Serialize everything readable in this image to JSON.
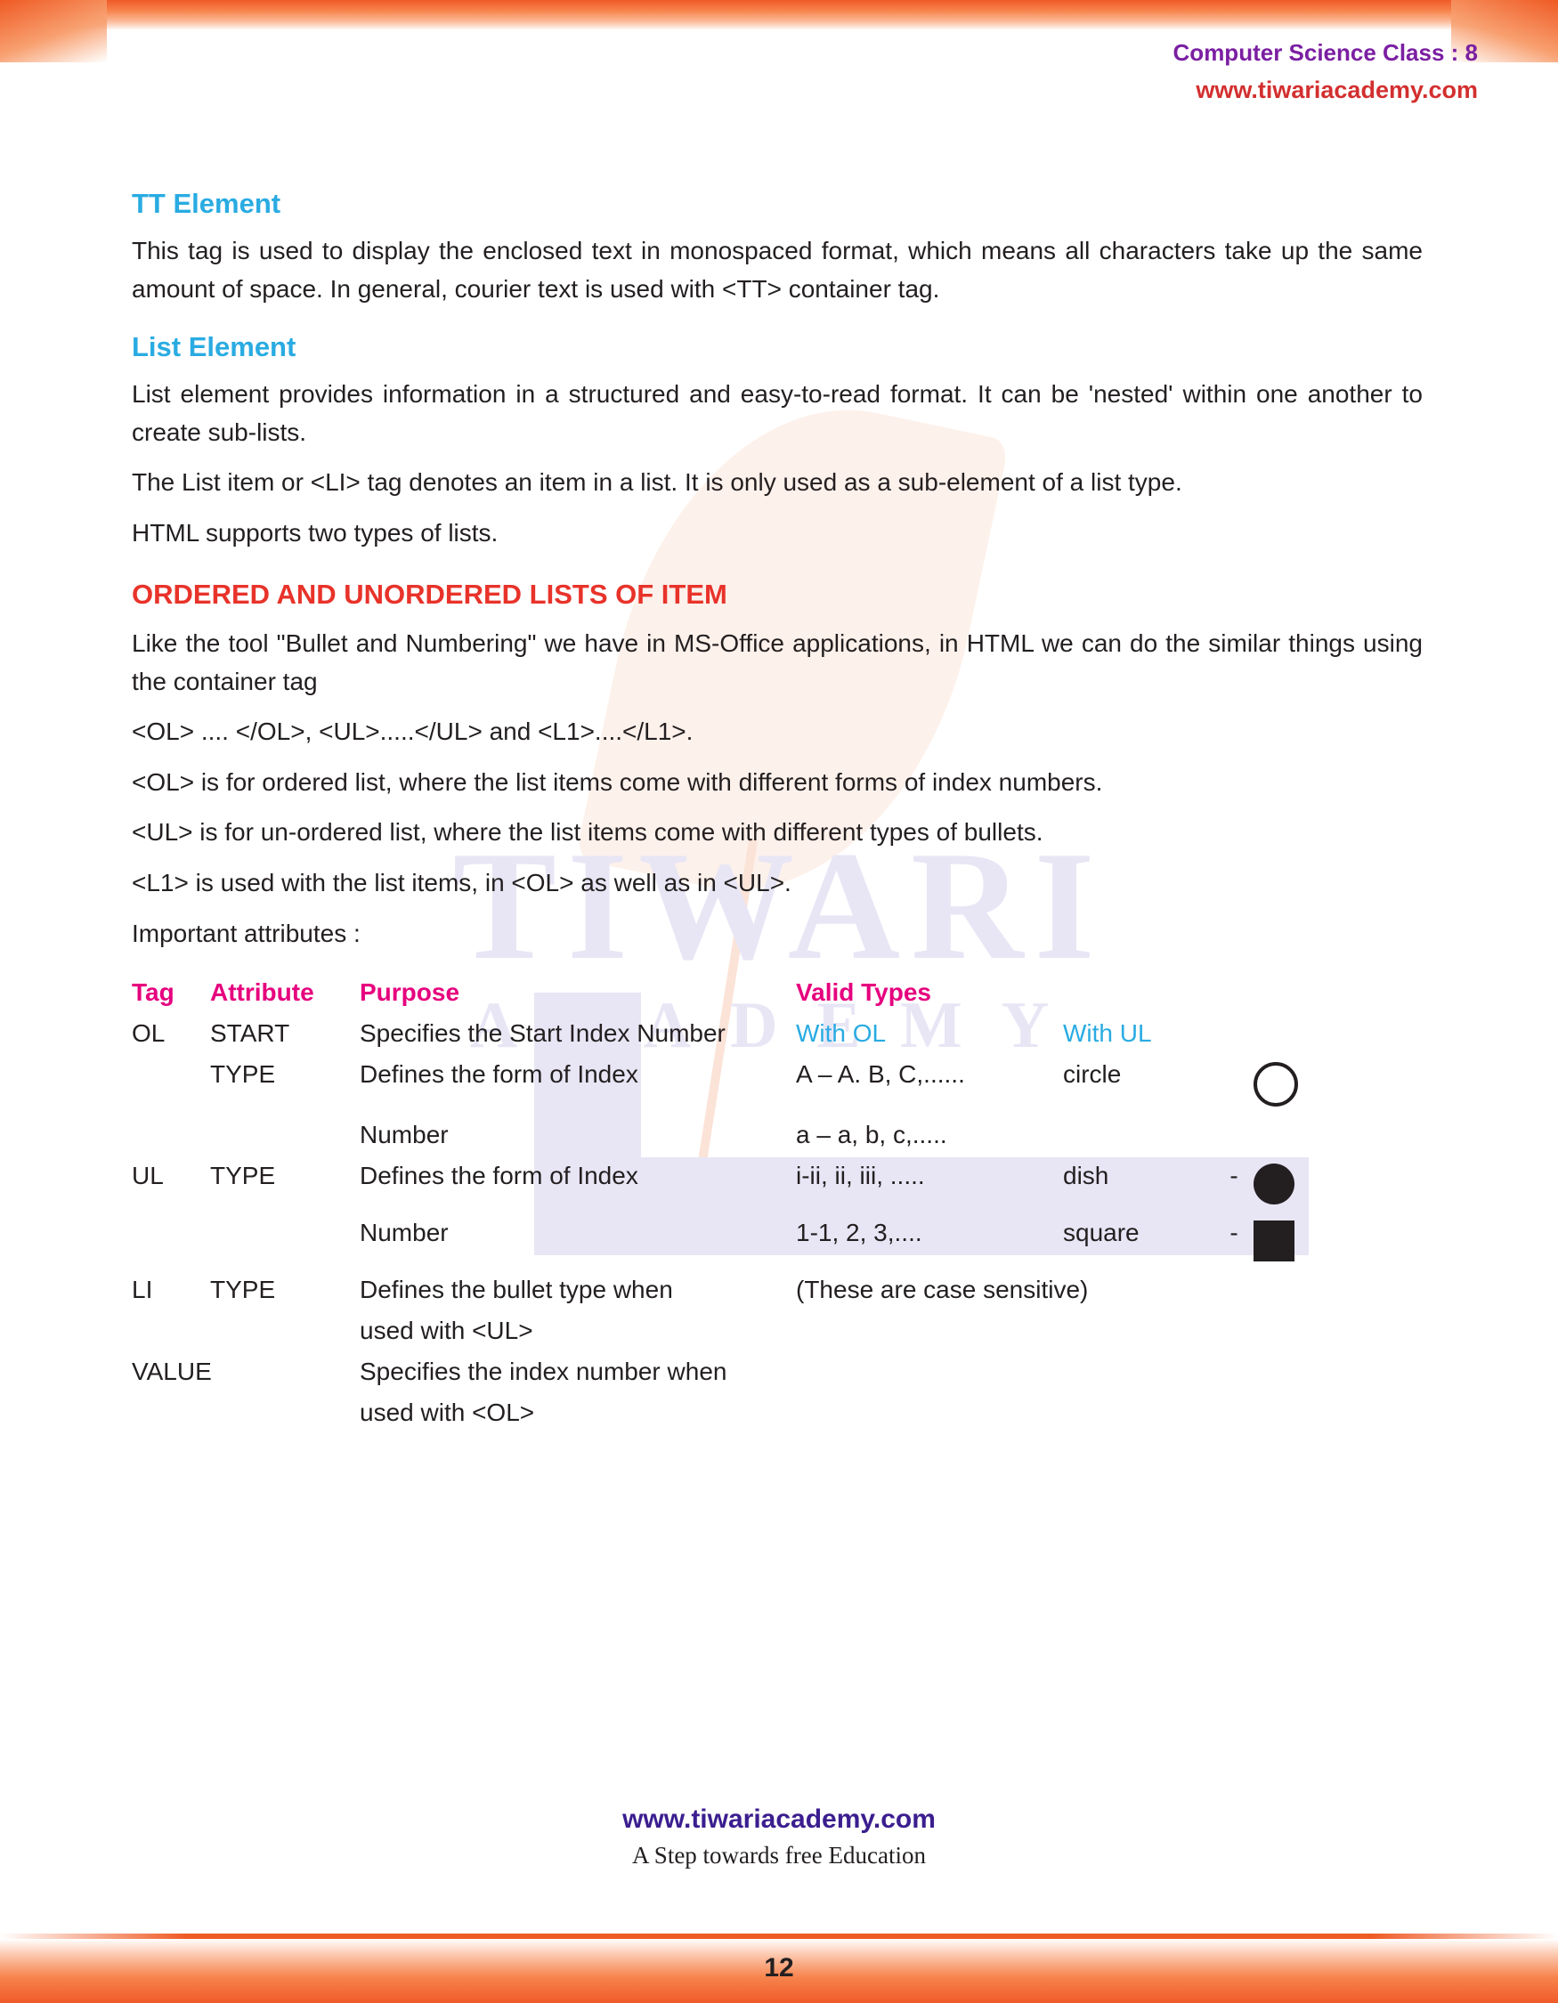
{
  "header": {
    "title": "Computer Science Class : 8",
    "website": "www.tiwariacademy.com"
  },
  "watermark": {
    "line1": "TIWARI",
    "line2": "ACADEMY"
  },
  "sections": {
    "tt_heading": "TT Element",
    "tt_para": "This tag is used to display the enclosed text in monospaced format, which means all characters take up the same amount of space. In general, courier text is used with <TT> container tag.",
    "list_heading": "List Element",
    "list_para1": "List element provides information in a structured and easy-to-read format. It can be 'nested' within one another to create sub-lists.",
    "list_para2": "The List item or <LI> tag denotes an item in a list. It is only used as a sub-element of a list type.",
    "list_para3": "HTML supports two types of lists.",
    "ordered_heading": "ORDERED AND UNORDERED LISTS OF ITEM",
    "ordered_para1": "Like the tool \"Bullet and Numbering\" we have in MS-Office applications, in HTML we can do the similar things using the container tag",
    "ordered_para2": "<OL> .... </OL>,  <UL>.....</UL> and <L1>....</L1>.",
    "ordered_para3": "<OL> is for ordered list, where the list items come with different forms of index numbers.",
    "ordered_para4": "<UL> is for un-ordered list, where the list items come with different types of bullets.",
    "ordered_para5": "<L1> is used with the list items, in <OL> as well as in <UL>.",
    "attributes_label": "Important attributes :"
  },
  "table": {
    "headers": {
      "tag": "Tag",
      "attribute": "Attribute",
      "purpose": "Purpose",
      "valid_types": "Valid Types"
    },
    "rows": [
      {
        "tag": "OL",
        "attribute": "START",
        "purpose": "Specifies the Start Index Number",
        "valid": "With OL",
        "ul": "With UL",
        "dash": "",
        "mark": ""
      },
      {
        "tag": "",
        "attribute": "TYPE",
        "purpose": "Defines the form of Index",
        "valid": "A – A. B, C,......",
        "ul": "circle",
        "dash": "",
        "mark": "circle-bullet-icon"
      },
      {
        "tag": "",
        "attribute": "",
        "purpose": "Number",
        "valid": "a – a, b, c,.....",
        "ul": "",
        "dash": "",
        "mark": ""
      },
      {
        "tag": "UL",
        "attribute": "TYPE",
        "purpose": "Defines the form of Index",
        "valid": "i-ii, ii, iii, .....",
        "ul": "dish",
        "dash": "-",
        "mark": "disc-bullet-icon"
      },
      {
        "tag": "",
        "attribute": "",
        "purpose": "Number",
        "valid": "1-1, 2, 3,....",
        "ul": "square",
        "dash": "-",
        "mark": "square-bullet-icon"
      },
      {
        "tag": "LI",
        "attribute": "TYPE",
        "purpose": "Defines the bullet type when",
        "valid": "(These are case sensitive)",
        "ul": "",
        "dash": "",
        "mark": ""
      },
      {
        "tag": "",
        "attribute": "",
        "purpose": "used with <UL>",
        "valid": "",
        "ul": "",
        "dash": "",
        "mark": ""
      },
      {
        "tag": "VALUE",
        "attribute": "",
        "purpose": "Specifies the index number when",
        "valid": "",
        "ul": "",
        "dash": "",
        "mark": ""
      },
      {
        "tag": "",
        "attribute": "",
        "purpose": "used with <OL>",
        "valid": "",
        "ul": "",
        "dash": "",
        "mark": ""
      }
    ]
  },
  "footer": {
    "website": "www.tiwariacademy.com",
    "tagline": "A Step towards free Education",
    "page_number": "12"
  },
  "colors": {
    "accent_orange": "#f05a28",
    "heading_blue": "#29abe2",
    "heading_red": "#e8332a",
    "table_head_pink": "#e6007e",
    "header_purple": "#7b1fa2",
    "header_red": "#d32f2f",
    "footer_purple": "#3b1e8f"
  }
}
